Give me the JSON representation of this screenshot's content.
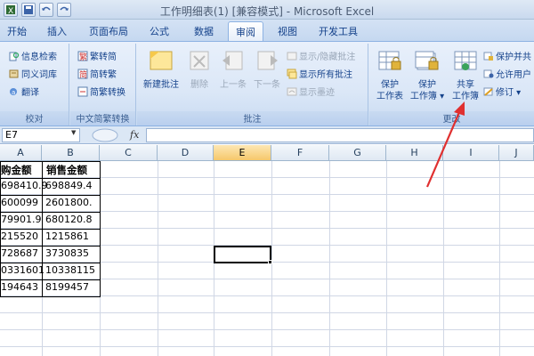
{
  "window": {
    "title": "工作明细表(1) [兼容模式] - Microsoft Excel"
  },
  "tabs": [
    {
      "label": "开始"
    },
    {
      "label": "插入"
    },
    {
      "label": "页面布局"
    },
    {
      "label": "公式"
    },
    {
      "label": "数据"
    },
    {
      "label": "审阅",
      "active": true
    },
    {
      "label": "视图"
    },
    {
      "label": "开发工具"
    }
  ],
  "ribbon": {
    "proofing": {
      "label": "校对",
      "items": [
        "信息检索",
        "同义词库",
        "翻译"
      ]
    },
    "chinese": {
      "label": "中文简繁转换",
      "items": [
        "繁转简",
        "简转繁",
        "简繁转换"
      ]
    },
    "comments": {
      "label": "批注",
      "new_comment": "新建批注",
      "delete": "删除",
      "previous": "上一条",
      "next": "下一条",
      "show_hide": "显示/隐藏批注",
      "show_all": "显示所有批注",
      "show_ink": "显示墨迹"
    },
    "changes": {
      "label": "更改",
      "protect_sheet": [
        "保护",
        "工作表"
      ],
      "protect_workbook": [
        "保护",
        "工作簿"
      ],
      "share_workbook": [
        "共享",
        "工作簿"
      ],
      "protect_and_share": "保护并共",
      "allow_users": "允许用户",
      "track_changes": "修订"
    }
  },
  "formula_bar": {
    "name_box": "E7",
    "fx_label": "fx",
    "value": ""
  },
  "columns": [
    "A",
    "B",
    "C",
    "D",
    "E",
    "F",
    "G",
    "H",
    "I",
    "J"
  ],
  "selected_column": "E",
  "selected_cell": "E7",
  "table": {
    "headers": [
      "购金额",
      "销售金额"
    ],
    "rows": [
      [
        "698410.9",
        "698849.4"
      ],
      [
        "600099",
        "2601800."
      ],
      [
        "79901.9",
        "680120.8"
      ],
      [
        "215520",
        "1215861"
      ],
      [
        "728687",
        "3730835"
      ],
      [
        "0331601",
        "10338115"
      ],
      [
        "194643",
        "8199457"
      ]
    ]
  },
  "colors": {
    "ribbon_bg": "#dbe7f7",
    "accent_text": "#15428b",
    "annotation_arrow": "#e03030",
    "selected_col_header": "#f6c86b"
  }
}
